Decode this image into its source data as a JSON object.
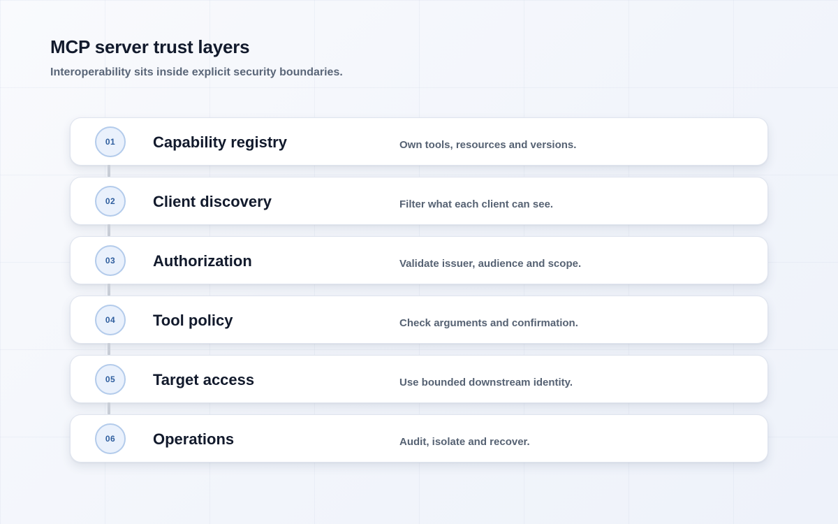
{
  "header": {
    "title": "MCP server trust layers",
    "subtitle": "Interoperability sits inside explicit security boundaries."
  },
  "colors": {
    "card_background": "#ffffff",
    "badge_fill": "#eaf1fc",
    "badge_border": "#b3cbeb",
    "badge_text": "#2f5e9e",
    "heading_text": "#121a2c",
    "description_text": "#566273",
    "connector": "#c9ced7"
  },
  "layers": [
    {
      "step": "01",
      "name": "Capability registry",
      "description": "Own tools, resources and versions."
    },
    {
      "step": "02",
      "name": "Client discovery",
      "description": "Filter what each client can see."
    },
    {
      "step": "03",
      "name": "Authorization",
      "description": "Validate issuer, audience and scope."
    },
    {
      "step": "04",
      "name": "Tool policy",
      "description": "Check arguments and confirmation."
    },
    {
      "step": "05",
      "name": "Target access",
      "description": "Use bounded downstream identity."
    },
    {
      "step": "06",
      "name": "Operations",
      "description": "Audit, isolate and recover."
    }
  ]
}
